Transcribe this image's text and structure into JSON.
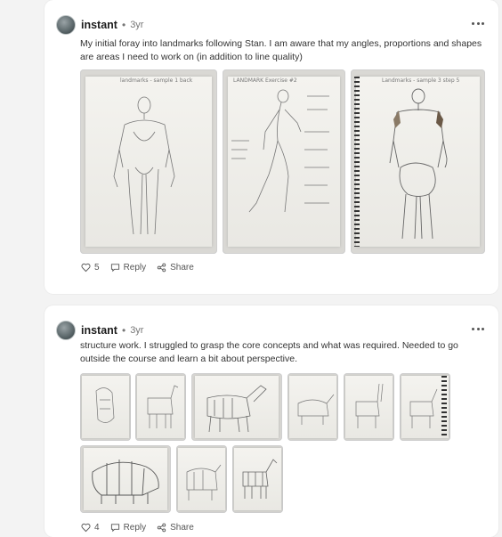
{
  "posts": [
    {
      "username": "instant",
      "separator": "•",
      "time": "3yr",
      "text": "My initial foray into landmarks following Stan. I am aware that my angles, proportions and shapes are areas I need to work on (in addition to line quality)",
      "likes": "5",
      "reply_label": "Reply",
      "share_label": "Share",
      "images": [
        {
          "caption": "landmarks - sample 1 back"
        },
        {
          "caption": "LANDMARK Exercise #2"
        },
        {
          "caption": "Landmarks - sample 3 step 5"
        }
      ]
    },
    {
      "username": "instant",
      "separator": "•",
      "time": "3yr",
      "text": "structure work. I struggled to grasp the core concepts and what was required. Needed to go outside the course and learn a bit about perspective.",
      "likes": "4",
      "reply_label": "Reply",
      "share_label": "Share"
    }
  ],
  "icons": {
    "heart": "heart-icon",
    "reply": "comment-icon",
    "share": "share-icon",
    "more": "more-horizontal-icon"
  },
  "colors": {
    "page_bg": "#f3f3f3",
    "card_bg": "#ffffff",
    "text": "#333333",
    "muted": "#777777"
  }
}
